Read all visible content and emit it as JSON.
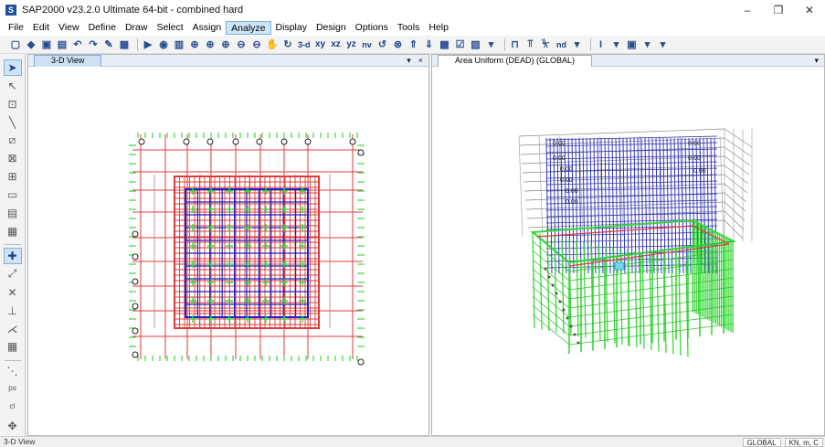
{
  "window": {
    "title": "SAP2000 v23.2.0 Ultimate 64-bit - combined hard",
    "app_icon_letter": "S",
    "controls": [
      "–",
      "❐",
      "✕"
    ]
  },
  "menu": {
    "items": [
      {
        "label": "File"
      },
      {
        "label": "Edit"
      },
      {
        "label": "View"
      },
      {
        "label": "Define"
      },
      {
        "label": "Draw"
      },
      {
        "label": "Select"
      },
      {
        "label": "Assign"
      },
      {
        "label": "Analyze",
        "active": true
      },
      {
        "label": "Display"
      },
      {
        "label": "Design"
      },
      {
        "label": "Options"
      },
      {
        "label": "Tools"
      },
      {
        "label": "Help"
      }
    ]
  },
  "toolbar": {
    "view_buttons": {
      "v3d": "3-d",
      "xy": "xy",
      "xz": "xz",
      "yz": "yz",
      "nv": "nv"
    },
    "nd_label": "nd"
  },
  "left_pane": {
    "tab_label": "3-D View",
    "pin": "▾",
    "close": "×"
  },
  "right_pane": {
    "tab_label": "Area Uniform (DEAD) (GLOBAL)",
    "dropdown": "▾",
    "load_value_label": "0.00"
  },
  "status": {
    "left": "3-D View",
    "coord_system": "GLOBAL",
    "units": "KN, m, C"
  },
  "colors": {
    "grid_red": "#e03a3a",
    "beam_blue": "#1c22c8",
    "column_green": "#39d839",
    "grid_bubble": "#222222",
    "accent_blue": "#cce4f7"
  }
}
